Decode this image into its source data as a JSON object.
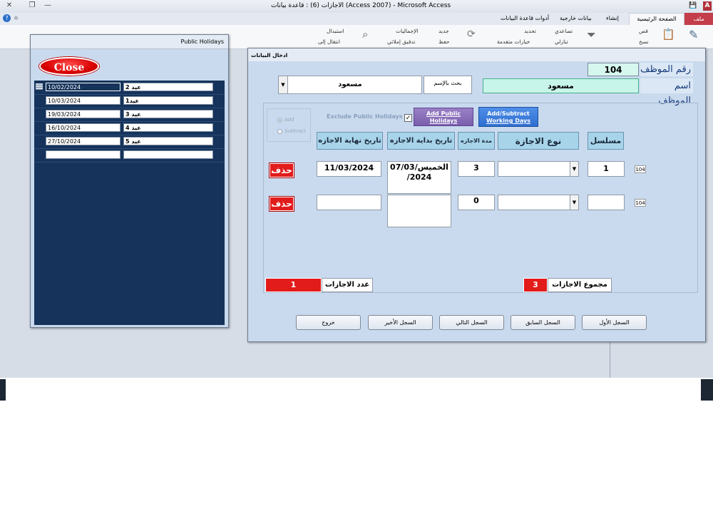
{
  "window": {
    "title": "الاجازات (6) : قاعدة بيانات (Access 2007) - Microsoft Access",
    "quick_access": "A"
  },
  "ribbon": {
    "file_tab": "ملف",
    "tabs": [
      "الصفحة الرئيسية",
      "إنشاء",
      "بيانات خارجية",
      "أدوات قاعدة البيانات"
    ],
    "items": {
      "cut": "قص",
      "copy": "نسخ",
      "ascending": "تصاعدي",
      "descending": "تنازلي",
      "selection": "تحديد",
      "advanced": "خيارات متقدمة",
      "new": "جديد",
      "save": "حفظ",
      "totals": "الإجماليات",
      "spelling": "تدقيق إملائي",
      "replace": "استبدال",
      "goto": "انتقال إلى"
    }
  },
  "holidays_form": {
    "title": "Public Holidays",
    "close_label": "Close",
    "rows": [
      {
        "date": "10/02/2024",
        "name": "عيد 2"
      },
      {
        "date": "10/03/2024",
        "name": "عيد1"
      },
      {
        "date": "19/03/2024",
        "name": "عيد 3"
      },
      {
        "date": "16/10/2024",
        "name": "عيد 4"
      },
      {
        "date": "27/10/2024",
        "name": "عيد 5"
      },
      {
        "date": "",
        "name": ""
      }
    ]
  },
  "main_form": {
    "title": "ادخال البيانات",
    "employee_id_label": "رقم الموظف",
    "employee_id": "104",
    "employee_name_label": "اسم الموظف",
    "employee_name": "مسعود",
    "search_label": "بحث بالإسم",
    "search_value": "مسعود",
    "option_add": "Add",
    "option_subtract": "Subtract",
    "exclude_label": "Exclude Public Holidays",
    "exclude_checked": "✓",
    "add_holidays_label_1": "Add Public",
    "add_holidays_label_2": "Holidays",
    "addsub_label_1": "Add/Subtract",
    "addsub_label_2": "Working Days",
    "headers": {
      "serial": "مسلسل",
      "type": "نوع الاجازة",
      "duration": "مدة الاجازه",
      "start": "تاريخ بداية الاجازه",
      "end": "تاريخ نهاية الاجازه"
    },
    "rows": [
      {
        "rowid": "104",
        "serial": "1",
        "type": "",
        "duration": "3",
        "start_1": "الخميس/07/03",
        "start_2": "/2024",
        "end": "11/03/2024",
        "delete": "حذف"
      },
      {
        "rowid": "104",
        "serial": "",
        "type": "",
        "duration": "0",
        "start_1": "",
        "start_2": "",
        "end": "",
        "delete": "حذف"
      }
    ],
    "total_label": "مجموع الاجازات",
    "total_value": "3",
    "count_label": "عدد الاجازات",
    "count_value": "1",
    "nav": {
      "first": "السجل الأول",
      "previous": "السجل السابق",
      "next": "السجل التالي",
      "last": "السجل الأخير",
      "exit": "خروج"
    }
  }
}
